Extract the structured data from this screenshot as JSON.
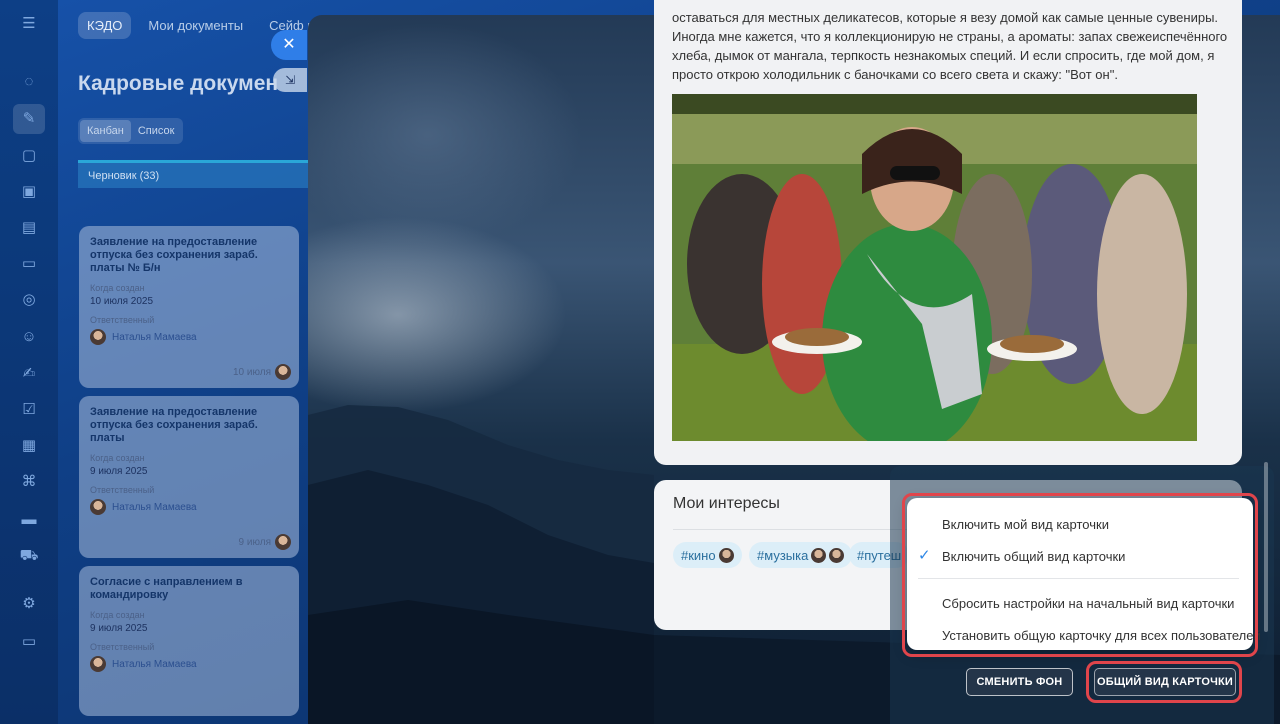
{
  "rail": {
    "icons": [
      "menu-icon",
      "chat-icon",
      "documents-icon",
      "messages-icon",
      "calendar-icon",
      "tasks-icon",
      "crm-icon",
      "target-icon",
      "contacts-icon",
      "sign-icon",
      "checklist-icon",
      "schedule-icon",
      "robot-icon",
      "store-icon",
      "cart-icon",
      "settings-icon",
      "more-icon"
    ]
  },
  "topnav": {
    "items": [
      "КЭДО",
      "Мои документы",
      "Сейф ко"
    ]
  },
  "page": {
    "title": "Кадровые докумен",
    "views": [
      "Канбан",
      "Список"
    ]
  },
  "kanban": {
    "column_title": "Черновик (33)",
    "cards": [
      {
        "title": "Заявление на предоставление отпуска без сохранения зараб. платы № Б/н",
        "created_label": "Когда создан",
        "created": "10 июля 2025",
        "resp_label": "Ответственный",
        "resp": "Наталья Мамаева",
        "date": "10 июля"
      },
      {
        "title": "Заявление на предоставление отпуска без сохранения зараб. платы",
        "created_label": "Когда создан",
        "created": "9 июля 2025",
        "resp_label": "Ответственный",
        "resp": "Наталья Мамаева",
        "date": "9 июля"
      },
      {
        "title": "Согласие с направлением в командировку",
        "created_label": "Когда создан",
        "created": "9 июля 2025",
        "resp_label": "Ответственный",
        "resp": "Наталья Мамаева",
        "date": ""
      }
    ]
  },
  "controls": {
    "close_glyph": "✕",
    "minimize_glyph": "⇲"
  },
  "post": {
    "text": "оставаться для местных деликатесов, которые я везу домой как самые ценные сувениры. Иногда мне кажется, что я коллекционирую не страны, а ароматы: запах свежеиспечённого хлеба, дымок от мангала, терпкость незнакомых специй. И если спросить, где мой дом, я просто открою холодильник с баночками со всего света и скажу: \"Вот он\"."
  },
  "interests": {
    "title": "Мои интересы",
    "tags": [
      "#кино",
      "#музыка",
      "#путеш"
    ]
  },
  "menu": {
    "items": [
      "Включить мой вид карточки",
      "Включить общий вид карточки",
      "Сбросить настройки на начальный вид карточки",
      "Установить общую карточку для всех пользователей"
    ],
    "checked_index": 1,
    "check_glyph": "✓"
  },
  "buttons": {
    "change_bg": "СМЕНИТЬ ФОН",
    "common_view": "ОБЩИЙ ВИД КАРТОЧКИ"
  },
  "colors": {
    "highlight": "#e0454b",
    "accent": "#2f87e6",
    "tag_bg": "#dceef8"
  }
}
